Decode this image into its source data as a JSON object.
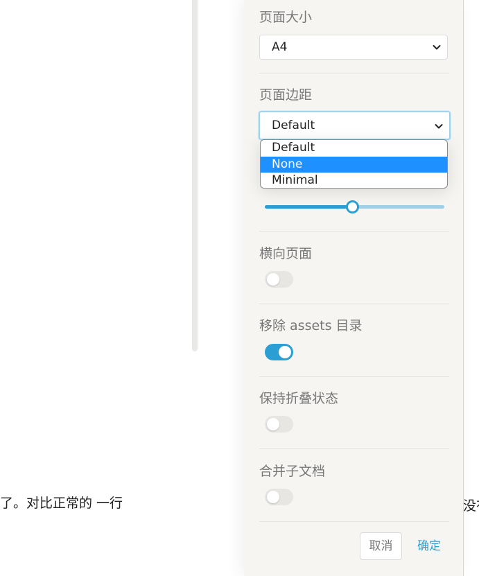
{
  "background": {
    "left_text": "了。对比正常的  一行",
    "right_text": "没有"
  },
  "panel": {
    "page_size": {
      "label": "页面大小",
      "value": "A4"
    },
    "page_margin": {
      "label": "页面边距",
      "value": "Default",
      "options": [
        "Default",
        "None",
        "Minimal"
      ],
      "highlighted": "None"
    },
    "slider": {
      "value_fraction": 0.49
    },
    "landscape": {
      "label": "横向页面",
      "on": false
    },
    "remove_assets": {
      "label": "移除 assets 目录",
      "on": true
    },
    "keep_fold": {
      "label": "保持折叠状态",
      "on": false
    },
    "merge_subdocs": {
      "label": "合并子文档",
      "on": false
    },
    "buttons": {
      "cancel": "取消",
      "confirm": "确定"
    }
  },
  "colors": {
    "accent": "#2b9fd4",
    "selected_option": "#1e90ff",
    "panel_bg": "#f6f5f2"
  },
  "icons": {
    "select_arrow": "chevron-down-icon"
  }
}
